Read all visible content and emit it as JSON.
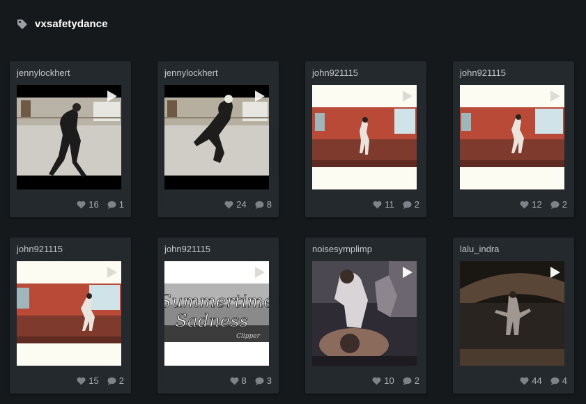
{
  "header": {
    "tag": "vxsafetydance",
    "icon": "tag-icon"
  },
  "posts": [
    {
      "user": "jennylockhert",
      "likes": "16",
      "comments": "1",
      "scene": "studio-white"
    },
    {
      "user": "jennylockhert",
      "likes": "24",
      "comments": "8",
      "scene": "studio-white-2"
    },
    {
      "user": "john921115",
      "likes": "11",
      "comments": "2",
      "scene": "red-room"
    },
    {
      "user": "john921115",
      "likes": "12",
      "comments": "2",
      "scene": "red-room-2"
    },
    {
      "user": "john921115",
      "likes": "15",
      "comments": "2",
      "scene": "red-room-3"
    },
    {
      "user": "john921115",
      "likes": "8",
      "comments": "3",
      "scene": "title-card",
      "overlay_text": [
        "Summertime",
        "Sadness"
      ],
      "overlay_sign": "Clipper"
    },
    {
      "user": "noisesymplimp",
      "likes": "10",
      "comments": "2",
      "scene": "party"
    },
    {
      "user": "lalu_indra",
      "likes": "44",
      "comments": "4",
      "scene": "dark-hall"
    }
  ],
  "colors": {
    "background": "#16191c",
    "card": "#24292d",
    "text": "#c3c7cb",
    "stats": "#aab0b5"
  }
}
